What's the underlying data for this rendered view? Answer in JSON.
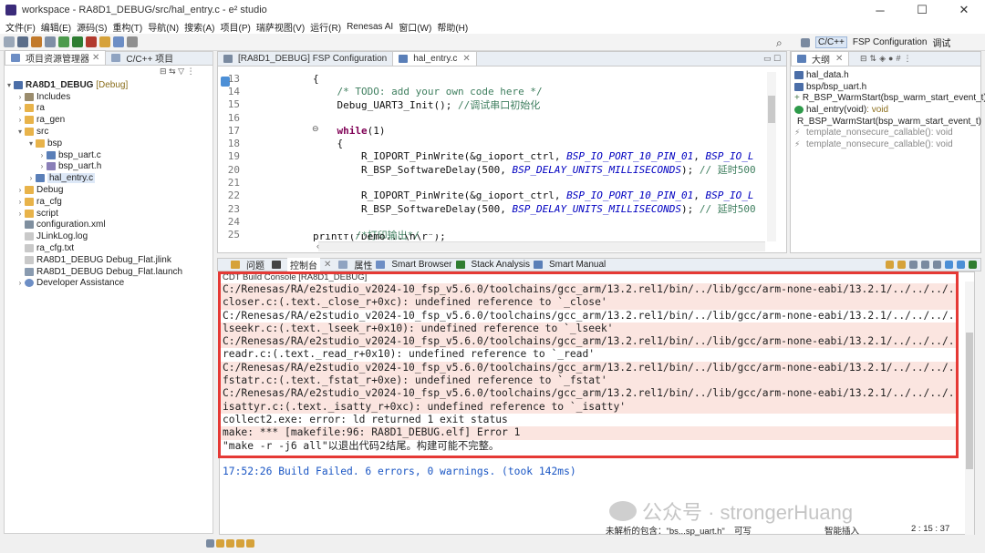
{
  "window": {
    "title": "workspace - RA8D1_DEBUG/src/hal_entry.c - e² studio",
    "controls": [
      "─",
      "☐",
      "✕"
    ]
  },
  "menu": [
    "文件(F)",
    "编辑(E)",
    "源码(S)",
    "重构(T)",
    "导航(N)",
    "搜索(A)",
    "项目(P)",
    "瑞萨视图(V)",
    "运行(R)",
    "Renesas AI",
    "窗口(W)",
    "帮助(H)"
  ],
  "perspectives": {
    "cpp": "C/C++",
    "fsp": "FSP Configuration",
    "debug": "调试"
  },
  "explorer": {
    "tabs": [
      "项目资源管理器",
      "C/C++ 项目"
    ],
    "project": "RA8D1_DEBUG",
    "project_tag": "[Debug]",
    "items": [
      {
        "label": "Includes"
      },
      {
        "label": "ra"
      },
      {
        "label": "ra_gen"
      },
      {
        "label": "src"
      },
      {
        "label": "bsp"
      },
      {
        "label": "bsp_uart.c"
      },
      {
        "label": "bsp_uart.h"
      },
      {
        "label": "hal_entry.c"
      },
      {
        "label": "Debug"
      },
      {
        "label": "ra_cfg"
      },
      {
        "label": "script"
      },
      {
        "label": "configuration.xml"
      },
      {
        "label": "JLinkLog.log"
      },
      {
        "label": "ra_cfg.txt"
      },
      {
        "label": "RA8D1_DEBUG Debug_Flat.jlink"
      },
      {
        "label": "RA8D1_DEBUG Debug_Flat.launch"
      },
      {
        "label": "Developer Assistance"
      }
    ]
  },
  "editor": {
    "tabs": [
      "[RA8D1_DEBUG] FSP Configuration",
      "hal_entry.c"
    ],
    "lines": [
      {
        "n": "13",
        "parts": [
          {
            "t": "{",
            "c": ""
          }
        ]
      },
      {
        "n": "14",
        "parts": [
          {
            "t": "    /* TODO: add your own code here */",
            "c": "cmt"
          }
        ]
      },
      {
        "n": "15",
        "parts": [
          {
            "t": "    Debug_UART3_Init(); ",
            "c": ""
          },
          {
            "t": "//调试串口初始化",
            "c": "cmt"
          }
        ]
      },
      {
        "n": "16",
        "parts": [
          {
            "t": "",
            "c": ""
          }
        ]
      },
      {
        "n": "17",
        "parts": [
          {
            "t": "    ",
            "c": ""
          },
          {
            "t": "while",
            "c": "kw"
          },
          {
            "t": "(1)",
            "c": ""
          }
        ]
      },
      {
        "n": "18",
        "parts": [
          {
            "t": "    {",
            "c": ""
          }
        ]
      },
      {
        "n": "19",
        "parts": [
          {
            "t": "        R_IOPORT_PinWrite(&g_ioport_ctrl, ",
            "c": ""
          },
          {
            "t": "BSP_IO_PORT_10_PIN_01",
            "c": "mac"
          },
          {
            "t": ", ",
            "c": ""
          },
          {
            "t": "BSP_IO_L",
            "c": "mac"
          }
        ]
      },
      {
        "n": "20",
        "parts": [
          {
            "t": "        R_BSP_SoftwareDelay(500, ",
            "c": ""
          },
          {
            "t": "BSP_DELAY_UNITS_MILLISECONDS",
            "c": "mac"
          },
          {
            "t": "); ",
            "c": ""
          },
          {
            "t": "// 延时500",
            "c": "cmt"
          }
        ]
      },
      {
        "n": "21",
        "parts": [
          {
            "t": "",
            "c": ""
          }
        ]
      },
      {
        "n": "22",
        "parts": [
          {
            "t": "        R_IOPORT_PinWrite(&g_ioport_ctrl, ",
            "c": ""
          },
          {
            "t": "BSP_IO_PORT_10_PIN_01",
            "c": "mac"
          },
          {
            "t": ", ",
            "c": ""
          },
          {
            "t": "BSP_IO_L",
            "c": "mac"
          }
        ]
      },
      {
        "n": "23",
        "parts": [
          {
            "t": "        R_BSP_SoftwareDelay(500, ",
            "c": ""
          },
          {
            "t": "BSP_DELAY_UNITS_MILLISECONDS",
            "c": "mac"
          },
          {
            "t": "); ",
            "c": ""
          },
          {
            "t": "// 延时500",
            "c": "cmt"
          }
        ]
      },
      {
        "n": "24",
        "parts": [
          {
            "t": "",
            "c": ""
          }
        ]
      },
      {
        "n": "25",
        "parts": [
          {
            "t": "       ",
            "c": ""
          },
          {
            "t": "/*打印输出*/",
            "c": "cmt"
          }
        ]
      }
    ],
    "partial_line": "      printf(\"Demo...\\n\\r\");"
  },
  "outline": {
    "tab": "大纲",
    "items": [
      {
        "label": "hal_data.h",
        "type": ""
      },
      {
        "label": "bsp/bsp_uart.h",
        "type": ""
      },
      {
        "label": "R_BSP_WarmStart(bsp_warm_start_event_t)",
        "type": ""
      },
      {
        "label": "hal_entry(void)",
        "type": " : void"
      },
      {
        "label": "R_BSP_WarmStart(bsp_warm_start_event_t)",
        "type": ""
      },
      {
        "label": "template_nonsecure_callable()",
        "type": " : void"
      },
      {
        "label": "template_nonsecure_callable()",
        "type": " : void"
      }
    ]
  },
  "bottom": {
    "tabs": [
      "问题",
      "控制台",
      "属性",
      "Smart Browser",
      "Stack Analysis",
      "Smart Manual"
    ],
    "console_title": "CDT Build Console [RA8D1_DEBUG]",
    "lines": [
      {
        "t": "C:/Renesas/RA/e2studio_v2024-10_fsp_v5.6.0/toolchains/gcc_arm/13.2.rel1/bin/../lib/gcc/arm-none-eabi/13.2.1/../../../../ar",
        "err": true
      },
      {
        "t": "closer.c:(.text._close_r+0xc): undefined reference to `_close'",
        "err": true
      },
      {
        "t": "C:/Renesas/RA/e2studio_v2024-10_fsp_v5.6.0/toolchains/gcc_arm/13.2.rel1/bin/../lib/gcc/arm-none-eabi/13.2.1/../../../../ar",
        "err": false
      },
      {
        "t": "lseekr.c:(.text._lseek_r+0x10): undefined reference to `_lseek'",
        "err": true
      },
      {
        "t": "C:/Renesas/RA/e2studio_v2024-10_fsp_v5.6.0/toolchains/gcc_arm/13.2.rel1/bin/../lib/gcc/arm-none-eabi/13.2.1/../../../../ar",
        "err": true
      },
      {
        "t": "readr.c:(.text._read_r+0x10): undefined reference to `_read'",
        "err": false
      },
      {
        "t": "C:/Renesas/RA/e2studio_v2024-10_fsp_v5.6.0/toolchains/gcc_arm/13.2.rel1/bin/../lib/gcc/arm-none-eabi/13.2.1/../../../../ar",
        "err": true
      },
      {
        "t": "fstatr.c:(.text._fstat_r+0xe): undefined reference to `_fstat'",
        "err": true
      },
      {
        "t": "C:/Renesas/RA/e2studio_v2024-10_fsp_v5.6.0/toolchains/gcc_arm/13.2.rel1/bin/../lib/gcc/arm-none-eabi/13.2.1/../../../../ar",
        "err": true
      },
      {
        "t": "isattyr.c:(.text._isatty_r+0xc): undefined reference to `_isatty'",
        "err": true
      },
      {
        "t": "collect2.exe: error: ld returned 1 exit status",
        "err": false
      },
      {
        "t": "make: *** [makefile:96: RA8D1_DEBUG.elf] Error 1",
        "err": true
      },
      {
        "t": "\"make -r -j6 all\"以退出代码2结尾。构建可能不完整。",
        "err": false
      }
    ],
    "result": "17:52:26 Build Failed. 6 errors, 0 warnings. (took 142ms)"
  },
  "status": {
    "selection": "未解析的包含：\"bs...sp_uart.h\"",
    "mode": "可写",
    "insert": "智能插入",
    "position": "2 : 15 : 37"
  },
  "watermark": "公众号 · strongerHuang",
  "colors": {
    "highlight": "#e53935",
    "error_bg": "#fbe5e0",
    "build_failed": "#1a56c4",
    "folder": "#e8b34a"
  }
}
